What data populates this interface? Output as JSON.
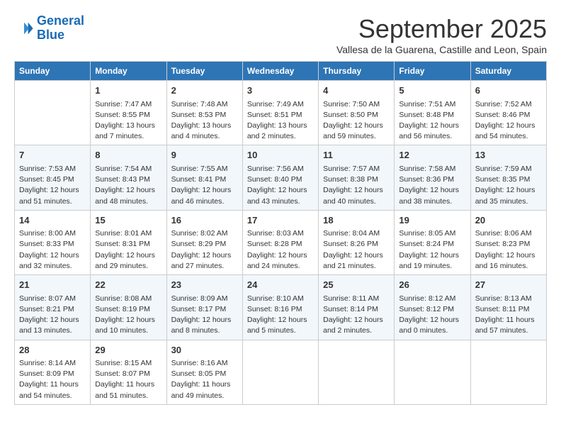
{
  "logo": {
    "line1": "General",
    "line2": "Blue"
  },
  "title": "September 2025",
  "subtitle": "Vallesa de la Guarena, Castille and Leon, Spain",
  "headers": [
    "Sunday",
    "Monday",
    "Tuesday",
    "Wednesday",
    "Thursday",
    "Friday",
    "Saturday"
  ],
  "weeks": [
    [
      {
        "day": "",
        "info": ""
      },
      {
        "day": "1",
        "info": "Sunrise: 7:47 AM\nSunset: 8:55 PM\nDaylight: 13 hours\nand 7 minutes."
      },
      {
        "day": "2",
        "info": "Sunrise: 7:48 AM\nSunset: 8:53 PM\nDaylight: 13 hours\nand 4 minutes."
      },
      {
        "day": "3",
        "info": "Sunrise: 7:49 AM\nSunset: 8:51 PM\nDaylight: 13 hours\nand 2 minutes."
      },
      {
        "day": "4",
        "info": "Sunrise: 7:50 AM\nSunset: 8:50 PM\nDaylight: 12 hours\nand 59 minutes."
      },
      {
        "day": "5",
        "info": "Sunrise: 7:51 AM\nSunset: 8:48 PM\nDaylight: 12 hours\nand 56 minutes."
      },
      {
        "day": "6",
        "info": "Sunrise: 7:52 AM\nSunset: 8:46 PM\nDaylight: 12 hours\nand 54 minutes."
      }
    ],
    [
      {
        "day": "7",
        "info": "Sunrise: 7:53 AM\nSunset: 8:45 PM\nDaylight: 12 hours\nand 51 minutes."
      },
      {
        "day": "8",
        "info": "Sunrise: 7:54 AM\nSunset: 8:43 PM\nDaylight: 12 hours\nand 48 minutes."
      },
      {
        "day": "9",
        "info": "Sunrise: 7:55 AM\nSunset: 8:41 PM\nDaylight: 12 hours\nand 46 minutes."
      },
      {
        "day": "10",
        "info": "Sunrise: 7:56 AM\nSunset: 8:40 PM\nDaylight: 12 hours\nand 43 minutes."
      },
      {
        "day": "11",
        "info": "Sunrise: 7:57 AM\nSunset: 8:38 PM\nDaylight: 12 hours\nand 40 minutes."
      },
      {
        "day": "12",
        "info": "Sunrise: 7:58 AM\nSunset: 8:36 PM\nDaylight: 12 hours\nand 38 minutes."
      },
      {
        "day": "13",
        "info": "Sunrise: 7:59 AM\nSunset: 8:35 PM\nDaylight: 12 hours\nand 35 minutes."
      }
    ],
    [
      {
        "day": "14",
        "info": "Sunrise: 8:00 AM\nSunset: 8:33 PM\nDaylight: 12 hours\nand 32 minutes."
      },
      {
        "day": "15",
        "info": "Sunrise: 8:01 AM\nSunset: 8:31 PM\nDaylight: 12 hours\nand 29 minutes."
      },
      {
        "day": "16",
        "info": "Sunrise: 8:02 AM\nSunset: 8:29 PM\nDaylight: 12 hours\nand 27 minutes."
      },
      {
        "day": "17",
        "info": "Sunrise: 8:03 AM\nSunset: 8:28 PM\nDaylight: 12 hours\nand 24 minutes."
      },
      {
        "day": "18",
        "info": "Sunrise: 8:04 AM\nSunset: 8:26 PM\nDaylight: 12 hours\nand 21 minutes."
      },
      {
        "day": "19",
        "info": "Sunrise: 8:05 AM\nSunset: 8:24 PM\nDaylight: 12 hours\nand 19 minutes."
      },
      {
        "day": "20",
        "info": "Sunrise: 8:06 AM\nSunset: 8:23 PM\nDaylight: 12 hours\nand 16 minutes."
      }
    ],
    [
      {
        "day": "21",
        "info": "Sunrise: 8:07 AM\nSunset: 8:21 PM\nDaylight: 12 hours\nand 13 minutes."
      },
      {
        "day": "22",
        "info": "Sunrise: 8:08 AM\nSunset: 8:19 PM\nDaylight: 12 hours\nand 10 minutes."
      },
      {
        "day": "23",
        "info": "Sunrise: 8:09 AM\nSunset: 8:17 PM\nDaylight: 12 hours\nand 8 minutes."
      },
      {
        "day": "24",
        "info": "Sunrise: 8:10 AM\nSunset: 8:16 PM\nDaylight: 12 hours\nand 5 minutes."
      },
      {
        "day": "25",
        "info": "Sunrise: 8:11 AM\nSunset: 8:14 PM\nDaylight: 12 hours\nand 2 minutes."
      },
      {
        "day": "26",
        "info": "Sunrise: 8:12 AM\nSunset: 8:12 PM\nDaylight: 12 hours\nand 0 minutes."
      },
      {
        "day": "27",
        "info": "Sunrise: 8:13 AM\nSunset: 8:11 PM\nDaylight: 11 hours\nand 57 minutes."
      }
    ],
    [
      {
        "day": "28",
        "info": "Sunrise: 8:14 AM\nSunset: 8:09 PM\nDaylight: 11 hours\nand 54 minutes."
      },
      {
        "day": "29",
        "info": "Sunrise: 8:15 AM\nSunset: 8:07 PM\nDaylight: 11 hours\nand 51 minutes."
      },
      {
        "day": "30",
        "info": "Sunrise: 8:16 AM\nSunset: 8:05 PM\nDaylight: 11 hours\nand 49 minutes."
      },
      {
        "day": "",
        "info": ""
      },
      {
        "day": "",
        "info": ""
      },
      {
        "day": "",
        "info": ""
      },
      {
        "day": "",
        "info": ""
      }
    ]
  ]
}
